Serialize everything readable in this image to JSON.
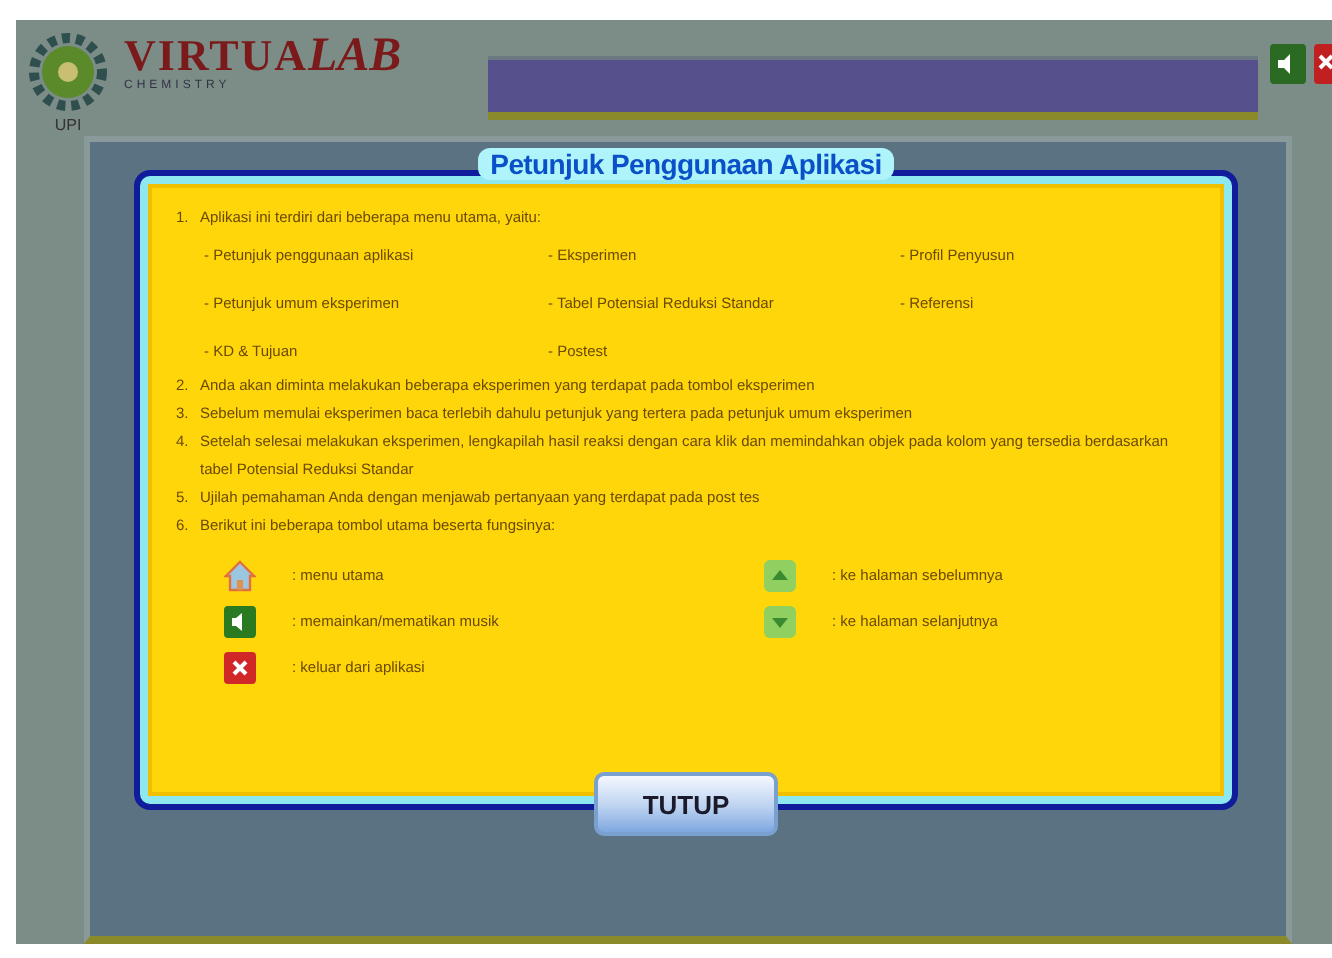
{
  "logo": {
    "word": "VIRTUA",
    "word_end": "LAB",
    "subtitle": "CHEMISTRY",
    "org": "UPI"
  },
  "dialog": {
    "title": "Petunjuk Penggunaan Aplikasi",
    "steps": [
      {
        "number": "1.",
        "text": "Aplikasi ini terdiri dari beberapa menu utama, yaitu:",
        "menu_items": [
          "- Petunjuk penggunaan aplikasi",
          "- Eksperimen",
          "- Profil Penyusun",
          "- Petunjuk umum eksperimen",
          "- Tabel Potensial Reduksi Standar",
          "- Referensi",
          "- KD & Tujuan",
          "- Postest"
        ]
      },
      {
        "number": "2.",
        "text": "Anda akan diminta melakukan beberapa eksperimen yang terdapat pada tombol eksperimen"
      },
      {
        "number": "3.",
        "text": "Sebelum memulai eksperimen baca terlebih dahulu petunjuk yang tertera pada petunjuk umum eksperimen"
      },
      {
        "number": "4.",
        "text": "Setelah selesai melakukan eksperimen, lengkapilah hasil reaksi dengan cara klik dan memindahkan objek pada kolom yang tersedia berdasarkan tabel Potensial Reduksi Standar"
      },
      {
        "number": "5.",
        "text": "Ujilah pemahaman Anda dengan menjawab pertanyaan yang terdapat pada post tes"
      },
      {
        "number": "6.",
        "text": "Berikut ini beberapa tombol utama beserta fungsinya:"
      }
    ],
    "legend": [
      {
        "kind": "home",
        "text": ": menu utama"
      },
      {
        "kind": "sound",
        "text": ": memainkan/mematikan musik"
      },
      {
        "kind": "exit",
        "text": ": keluar dari aplikasi"
      },
      {
        "kind": "previous",
        "text": ": ke halaman sebelumnya"
      },
      {
        "kind": "next",
        "text": ": ke halaman selanjutnya"
      }
    ],
    "close_button": "TUTUP"
  }
}
